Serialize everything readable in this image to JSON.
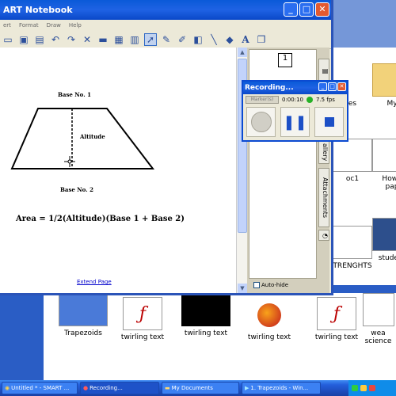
{
  "smart_window": {
    "title": "Untitled * - SMART Notebook",
    "title_visible": "ART Notebook",
    "menu": [
      "ert",
      "Format",
      "Draw",
      "Help"
    ],
    "toolbar_icons": [
      "open-icon",
      "save-icon",
      "paste-icon",
      "undo-icon",
      "redo-icon",
      "delete-icon",
      "screen-shade-icon",
      "fullscreen-icon",
      "table-icon",
      "select-icon",
      "pen-icon",
      "creative-pen-icon",
      "eraser-icon",
      "line-icon",
      "fill-icon",
      "text-icon",
      "properties-icon"
    ]
  },
  "canvas": {
    "base1": "Base No. 1",
    "base2": "Base No. 2",
    "altitude": "Altitude",
    "formula": "Area = 1/2(Altitude)(Base 1 + Base 2)",
    "link": "Extend Page"
  },
  "side_panel": {
    "page_number": "1",
    "tabs": [
      "allery",
      "Attachments"
    ],
    "autohide": "Auto-hide"
  },
  "recording_window": {
    "title": "Recording...",
    "marker": "Marker(s)",
    "time": "0:00:10",
    "fps": "7.5 fps",
    "status_color": "#26b126"
  },
  "explorer": {
    "partial_labels": {
      "es": "es",
      "my": "My",
      "oc1": "oc1",
      "howa": "Howa",
      "pap": "pap",
      "trenghts": "TRENGHTS",
      "student": "student",
      "wea": "wea",
      "scienc": "science"
    },
    "files": [
      {
        "name": "Trapezoids",
        "icon": "trapezoid-thumbnail"
      },
      {
        "name": "twirling text",
        "icon": "flash-icon"
      },
      {
        "name": "twirling text",
        "icon": "black-video-thumbnail"
      },
      {
        "name": "twirling text",
        "icon": "firefox-icon"
      },
      {
        "name": "twirling text",
        "icon": "flash-icon"
      }
    ]
  },
  "taskbar": {
    "items": [
      {
        "label": "Untitled * - SMART ...",
        "icon": "smart-icon"
      },
      {
        "label": "Recording...",
        "icon": "recording-icon"
      },
      {
        "label": "My Documents",
        "icon": "folder-icon"
      },
      {
        "label": "1. Trapezoids - Win...",
        "icon": "media-icon"
      }
    ]
  }
}
